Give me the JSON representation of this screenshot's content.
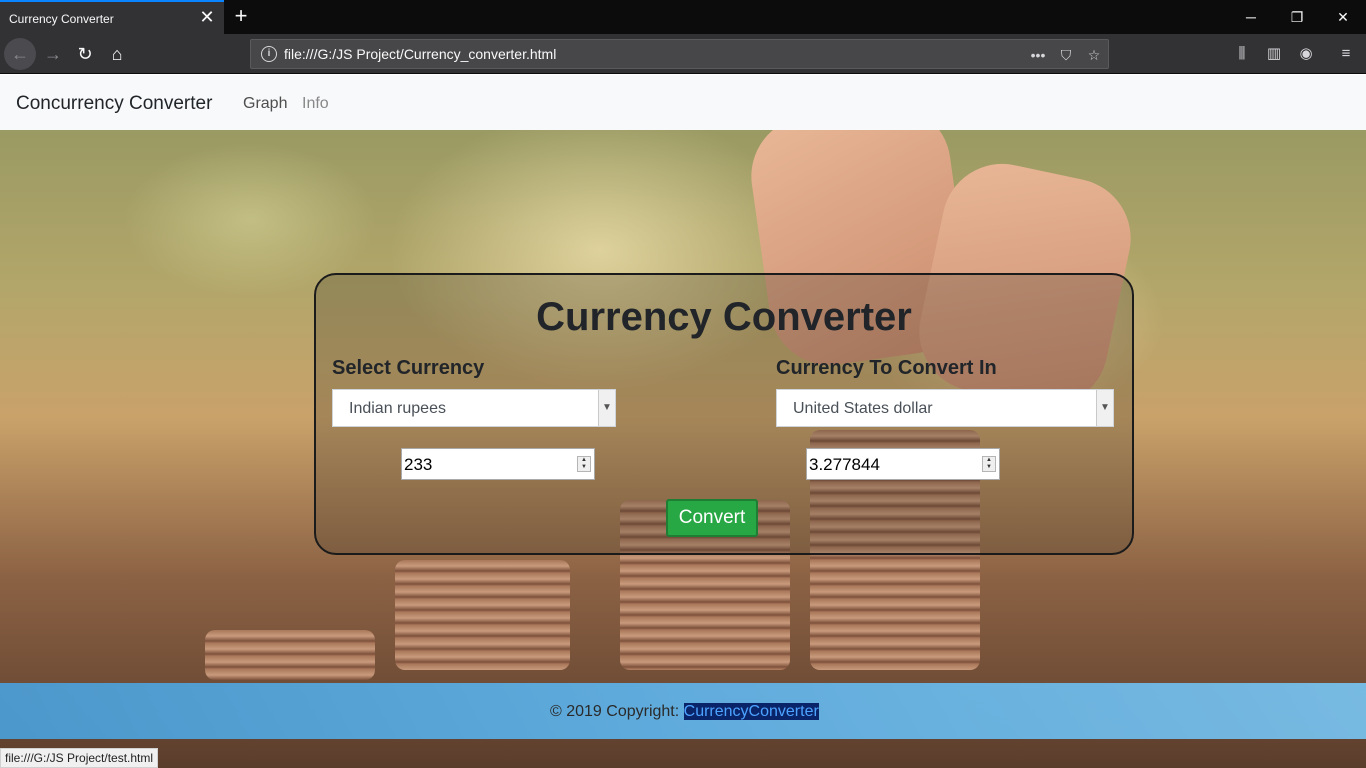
{
  "browser": {
    "tab_title": "Currency Converter",
    "tab_close_icon": "close-icon",
    "new_tab_icon": "plus-icon",
    "url": "file:///G:/JS Project/Currency_converter.html",
    "status_url": "file:///G:/JS Project/test.html"
  },
  "site": {
    "brand": "Concurrency Converter",
    "nav": {
      "graph": "Graph",
      "info": "Info"
    }
  },
  "converter": {
    "title": "Currency Converter",
    "from_label": "Select Currency",
    "to_label": "Currency To Convert In",
    "from_currency": "Indian rupees",
    "to_currency": "United States dollar",
    "amount": "233",
    "result": "3.277844",
    "convert_label": "Convert"
  },
  "footer": {
    "copyright": "© 2019 Copyright: ",
    "link": "CurrencyConverter"
  },
  "colors": {
    "accent_tab": "#0a84ff",
    "convert_button": "#28a745",
    "footer": "#5fb4eb"
  }
}
